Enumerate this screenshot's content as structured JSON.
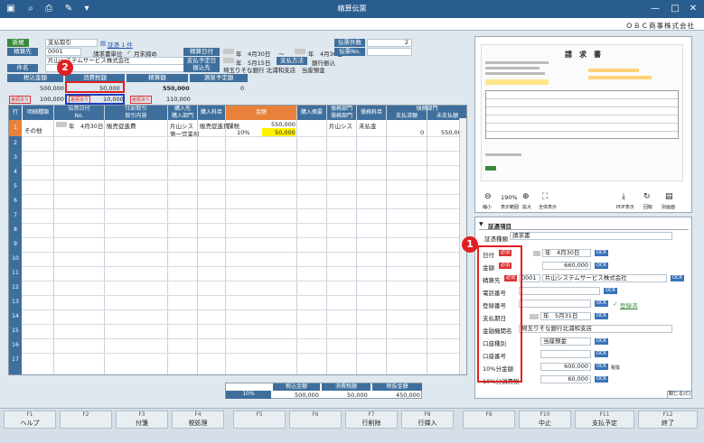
{
  "title": "精算伝票",
  "company": "ＯＢＣ商事株式会社",
  "header": {
    "new_label": "新規",
    "slip_type": "支払取引",
    "proof_link": "証憑 1 件",
    "dest_label": "精算先",
    "dest_code": "0001",
    "dest_unit": "請求書単位",
    "dest_closing": "月末締め",
    "dest_name": "片山システムサービス株式会社",
    "subject_label": "件名",
    "date_label": "精算日付",
    "date_from": "年　4月30日",
    "date_tilde": "～",
    "date_to": "年　4月30日",
    "pay_plan_label": "支払予定日",
    "pay_plan": "年　5月15日",
    "pay_method_label": "支払方法",
    "pay_method": "銀行振込",
    "bank_label": "振込先",
    "bank_value": "埼玉りそな銀行 北浦和支店　当座預金",
    "slip_count_label": "伝票件数",
    "slip_count": "2",
    "slip_no_label": "伝票No."
  },
  "summary": {
    "h1": "税込金額",
    "h2": "消費税額",
    "h3": "精算額",
    "h4": "源泉予定額",
    "v1": "500,000",
    "v2": "50,000",
    "v3": "550,000",
    "v4": "0",
    "tag_a": "差額あり",
    "v5": "100,000",
    "tag_b": "差額あり",
    "v6": "10,000",
    "tag_c": "差額あり",
    "v7": "110,000"
  },
  "grid": {
    "h_row": "行",
    "h_detail": "明細種類",
    "h_slip": "伝票日付",
    "h_slipno": "No.",
    "h_journal": "仕訳取引",
    "h_item": "取引内容",
    "h_buyer": "購入先",
    "h_dept": "購入部門",
    "h_subject": "購入科目",
    "h_amount": "金額",
    "h_desc": "購入摘要",
    "h_debt": "債務部門",
    "h_debt2": "債務科目",
    "h_debtdept": "債務部門",
    "h_payamt": "支払済額",
    "h_unpaid": "未支払額",
    "r1_kind": "その他",
    "r1_date": "年　4月30日",
    "r1_item": "販売促進費",
    "r1_buyer": "片山シス",
    "r1_dept": "販売促進費",
    "r1_dept2": "第一営業部",
    "r1_tax": "課税",
    "r1_tax_amt": "550,000",
    "r1_rate": "10%",
    "r1_rate_amt": "50,000",
    "r1_debtsub": "片山シス",
    "r1_debtsub2": "未払金",
    "r1_paid": "0",
    "r1_unpaid": "550,000"
  },
  "totals": {
    "h1": "税込金額",
    "h2": "消費税額",
    "h3": "税抜金額",
    "rate": "10%",
    "v1": "500,000",
    "v2": "50,000",
    "v3": "450,000"
  },
  "preview": {
    "doc_title": "請　求　書",
    "zoom": "190%",
    "btn_shrink": "縮小",
    "btn_fit": "表示範囲",
    "btn_enlarge": "拡大",
    "btn_full": "全体表示",
    "btn_pdf": "PDF表示",
    "btn_rotate": "回転",
    "btn_delete": "削除",
    "btn_register": "別画面"
  },
  "proof": {
    "section": "証憑項目",
    "type_label": "証憑種類",
    "type_value": "請求書",
    "date_label": "日付",
    "date_value": "年　4月30日",
    "amount_label": "金額",
    "amount_value": "660,000",
    "issuer_label": "精算先",
    "issuer_code": "0001",
    "issuer_name": "片山システムサービス株式会社",
    "tel_label": "電話番号",
    "reg_label": "登録番号",
    "reg_check": "登録済",
    "due_label": "支払期日",
    "due_value": "年　5月31日",
    "bank_label": "金融機関名",
    "bank_value": "埼玉りそな銀行北浦和支店",
    "acct_type_label": "口座種別",
    "acct_type_value": "当座預金",
    "acct_no_label": "口座番号",
    "tax10_label": "10%分金額",
    "tax10_value": "600,000",
    "tax10_extra": "税抜",
    "tax10c_label": "10%分消費税",
    "tax10c_value": "60,000",
    "req": "必須",
    "ocr": "OCR",
    "close": "閉じる(C)"
  },
  "fkeys": [
    {
      "k": "F1",
      "n": "ヘルプ"
    },
    {
      "k": "F2",
      "n": ""
    },
    {
      "k": "F3",
      "n": "付箋"
    },
    {
      "k": "F4",
      "n": "税処理"
    },
    {
      "k": "F5",
      "n": ""
    },
    {
      "k": "F6",
      "n": ""
    },
    {
      "k": "F7",
      "n": "行削除"
    },
    {
      "k": "F8",
      "n": "行挿入"
    },
    {
      "k": "F9",
      "n": ""
    },
    {
      "k": "F10",
      "n": "中止"
    },
    {
      "k": "F11",
      "n": "支払予定"
    },
    {
      "k": "F12",
      "n": "終了"
    }
  ],
  "badges": {
    "b1": "1",
    "b2": "2"
  },
  "colors": {
    "title": "#2a5d8f",
    "header": "#3e6f9c",
    "accent": "#e8823a",
    "highlight": "#fff200",
    "mark": "#e02020"
  }
}
